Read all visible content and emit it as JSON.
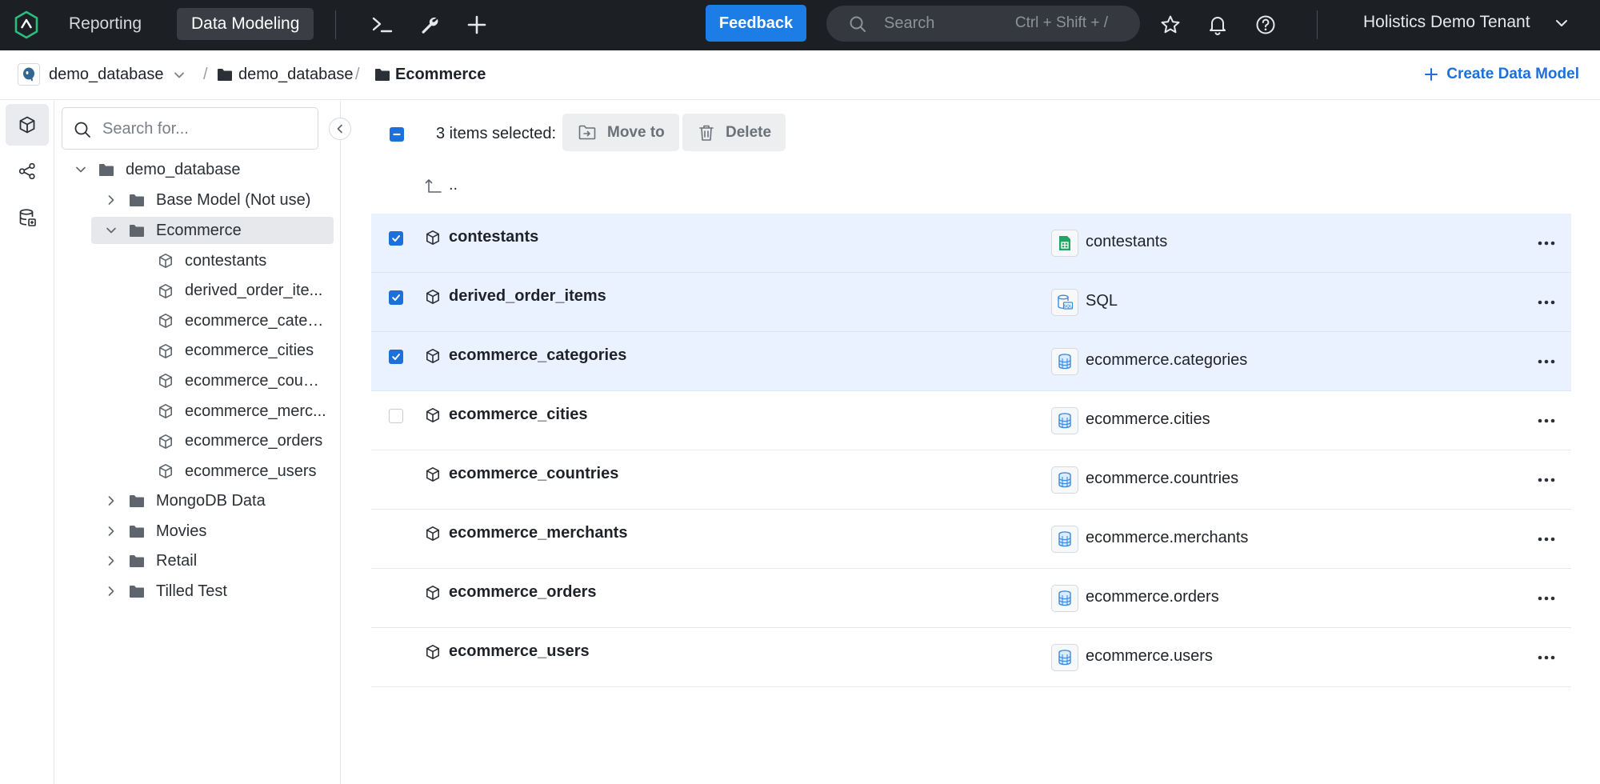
{
  "topbar": {
    "tabs": [
      {
        "label": "Reporting",
        "active": false
      },
      {
        "label": "Data Modeling",
        "active": true
      }
    ],
    "icons": [
      "terminal-icon",
      "wrench-icon",
      "plus-icon"
    ],
    "feedback_label": "Feedback",
    "search_placeholder": "Search",
    "search_shortcut": "Ctrl + Shift + /",
    "right_icons": [
      "star-icon",
      "bell-icon",
      "help-icon"
    ],
    "tenant": "Holistics Demo Tenant",
    "accent_color": "#1d7de6"
  },
  "breadcrumb": {
    "datasource": "demo_database",
    "items": [
      "demo_database",
      "Ecommerce"
    ],
    "create_label": "Create Data Model"
  },
  "rail": {
    "items": [
      "cube-icon",
      "relationships-icon",
      "database-icon"
    ],
    "active": 0
  },
  "tree": {
    "search_placeholder": "Search for...",
    "root": "demo_database",
    "folders": [
      {
        "label": "Base Model (Not use)",
        "expanded": false
      },
      {
        "label": "Ecommerce",
        "expanded": true,
        "selected": true
      },
      {
        "label": "MongoDB Data",
        "expanded": false
      },
      {
        "label": "Movies",
        "expanded": false
      },
      {
        "label": "Retail",
        "expanded": false
      },
      {
        "label": "Tilled Test",
        "expanded": false
      }
    ],
    "models": [
      "contestants",
      "derived_order_ite...",
      "ecommerce_categ...",
      "ecommerce_cities",
      "ecommerce_count...",
      "ecommerce_merc...",
      "ecommerce_orders",
      "ecommerce_users"
    ]
  },
  "selection": {
    "count_label": "3 items selected:",
    "move_label": "Move to",
    "delete_label": "Delete",
    "parent_label": ".."
  },
  "models": [
    {
      "name": "contestants",
      "source": "contestants",
      "source_type": "sheet",
      "checked": true,
      "checkbox_visible": true
    },
    {
      "name": "derived_order_items",
      "source": "SQL",
      "source_type": "sql",
      "checked": true,
      "checkbox_visible": true
    },
    {
      "name": "ecommerce_categories",
      "source": "ecommerce.categories",
      "source_type": "table",
      "checked": true,
      "checkbox_visible": true
    },
    {
      "name": "ecommerce_cities",
      "source": "ecommerce.cities",
      "source_type": "table",
      "checked": false,
      "checkbox_visible": true
    },
    {
      "name": "ecommerce_countries",
      "source": "ecommerce.countries",
      "source_type": "table",
      "checked": false,
      "checkbox_visible": false
    },
    {
      "name": "ecommerce_merchants",
      "source": "ecommerce.merchants",
      "source_type": "table",
      "checked": false,
      "checkbox_visible": false
    },
    {
      "name": "ecommerce_orders",
      "source": "ecommerce.orders",
      "source_type": "table",
      "checked": false,
      "checkbox_visible": false
    },
    {
      "name": "ecommerce_users",
      "source": "ecommerce.users",
      "source_type": "table",
      "checked": false,
      "checkbox_visible": false
    }
  ]
}
